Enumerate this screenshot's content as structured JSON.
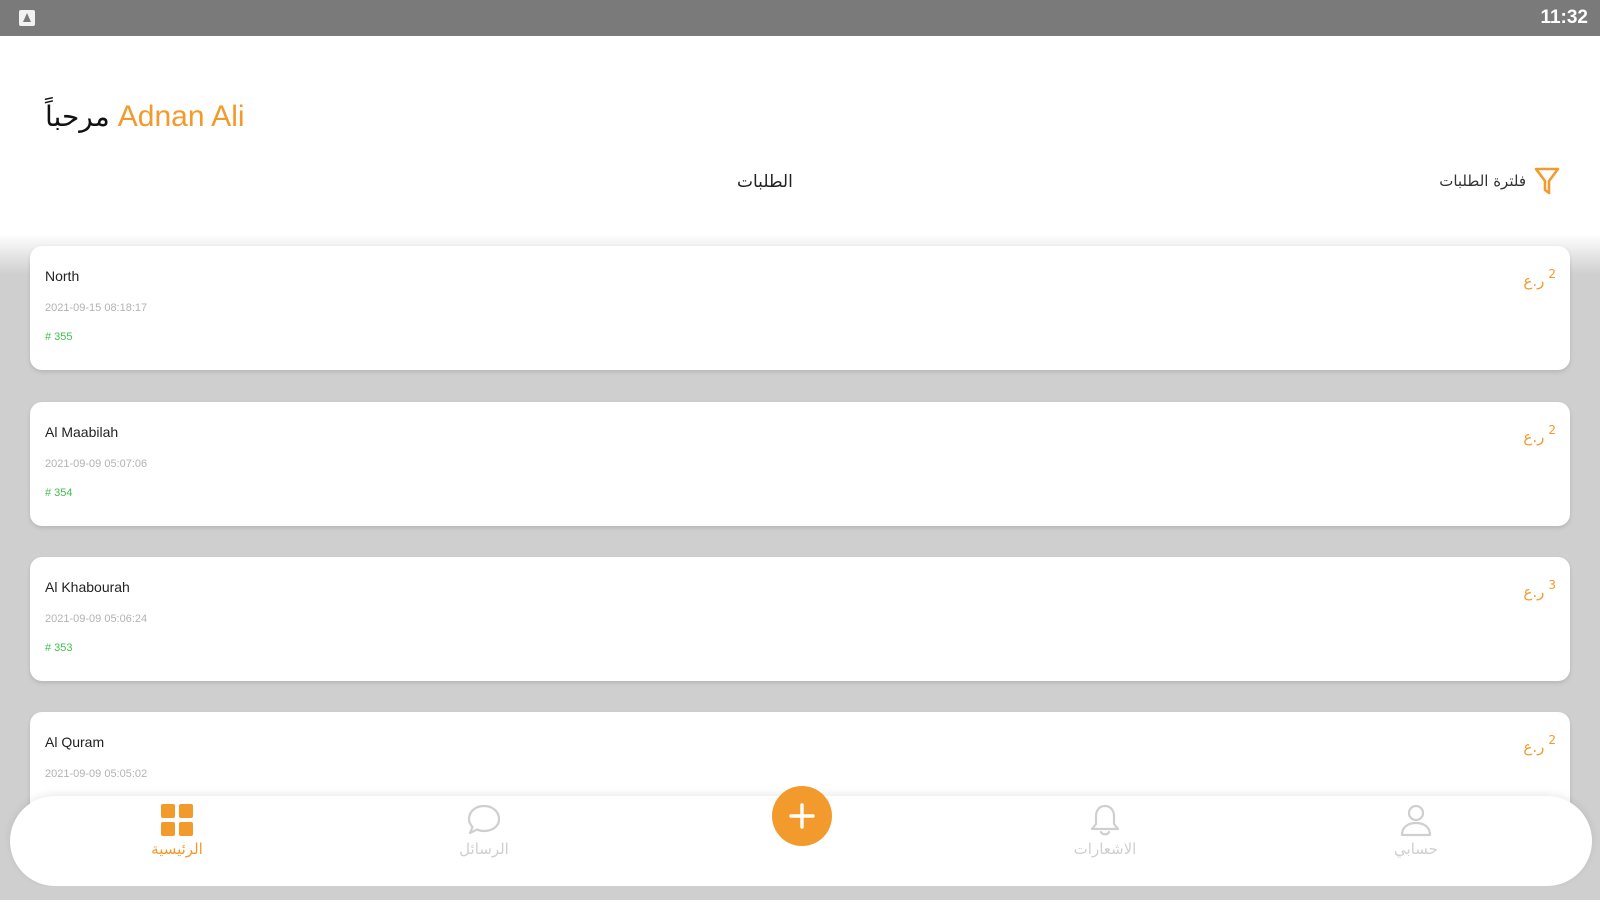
{
  "status_bar": {
    "time": "11:32"
  },
  "header": {
    "greeting_word": "مرحباً",
    "user_name": "Adnan Ali",
    "tab_label": "الطلبات",
    "filter_label": "فلترة الطلبات"
  },
  "orders": [
    {
      "title": "North",
      "date": "2021-09-15 08:18:17",
      "number": "# 355",
      "count": "2",
      "unit": "ر.ع"
    },
    {
      "title": "Al Maabilah",
      "date": "2021-09-09 05:07:06",
      "number": "# 354",
      "count": "2",
      "unit": "ر.ع"
    },
    {
      "title": "Al Khabourah",
      "date": "2021-09-09 05:06:24",
      "number": "# 353",
      "count": "3",
      "unit": "ر.ع"
    },
    {
      "title": "Al Quram",
      "date": "2021-09-09 05:05:02",
      "number": "",
      "count": "2",
      "unit": "ر.ع"
    }
  ],
  "bottom_nav": {
    "home_label": "الرئيسية",
    "messages_label": "الرسائل",
    "notifications_label": "الاشعارات",
    "account_label": "حسابي",
    "home_icon": "grid-icon",
    "messages_icon": "chat-bubble-icon",
    "add_icon": "plus-icon",
    "notifications_icon": "bell-icon",
    "account_icon": "user-icon"
  },
  "colors": {
    "accent": "#f39a2d",
    "status_bar": "#7a7a7a",
    "order_number": "#3fbf4f",
    "list_background": "#cfcfcf"
  }
}
